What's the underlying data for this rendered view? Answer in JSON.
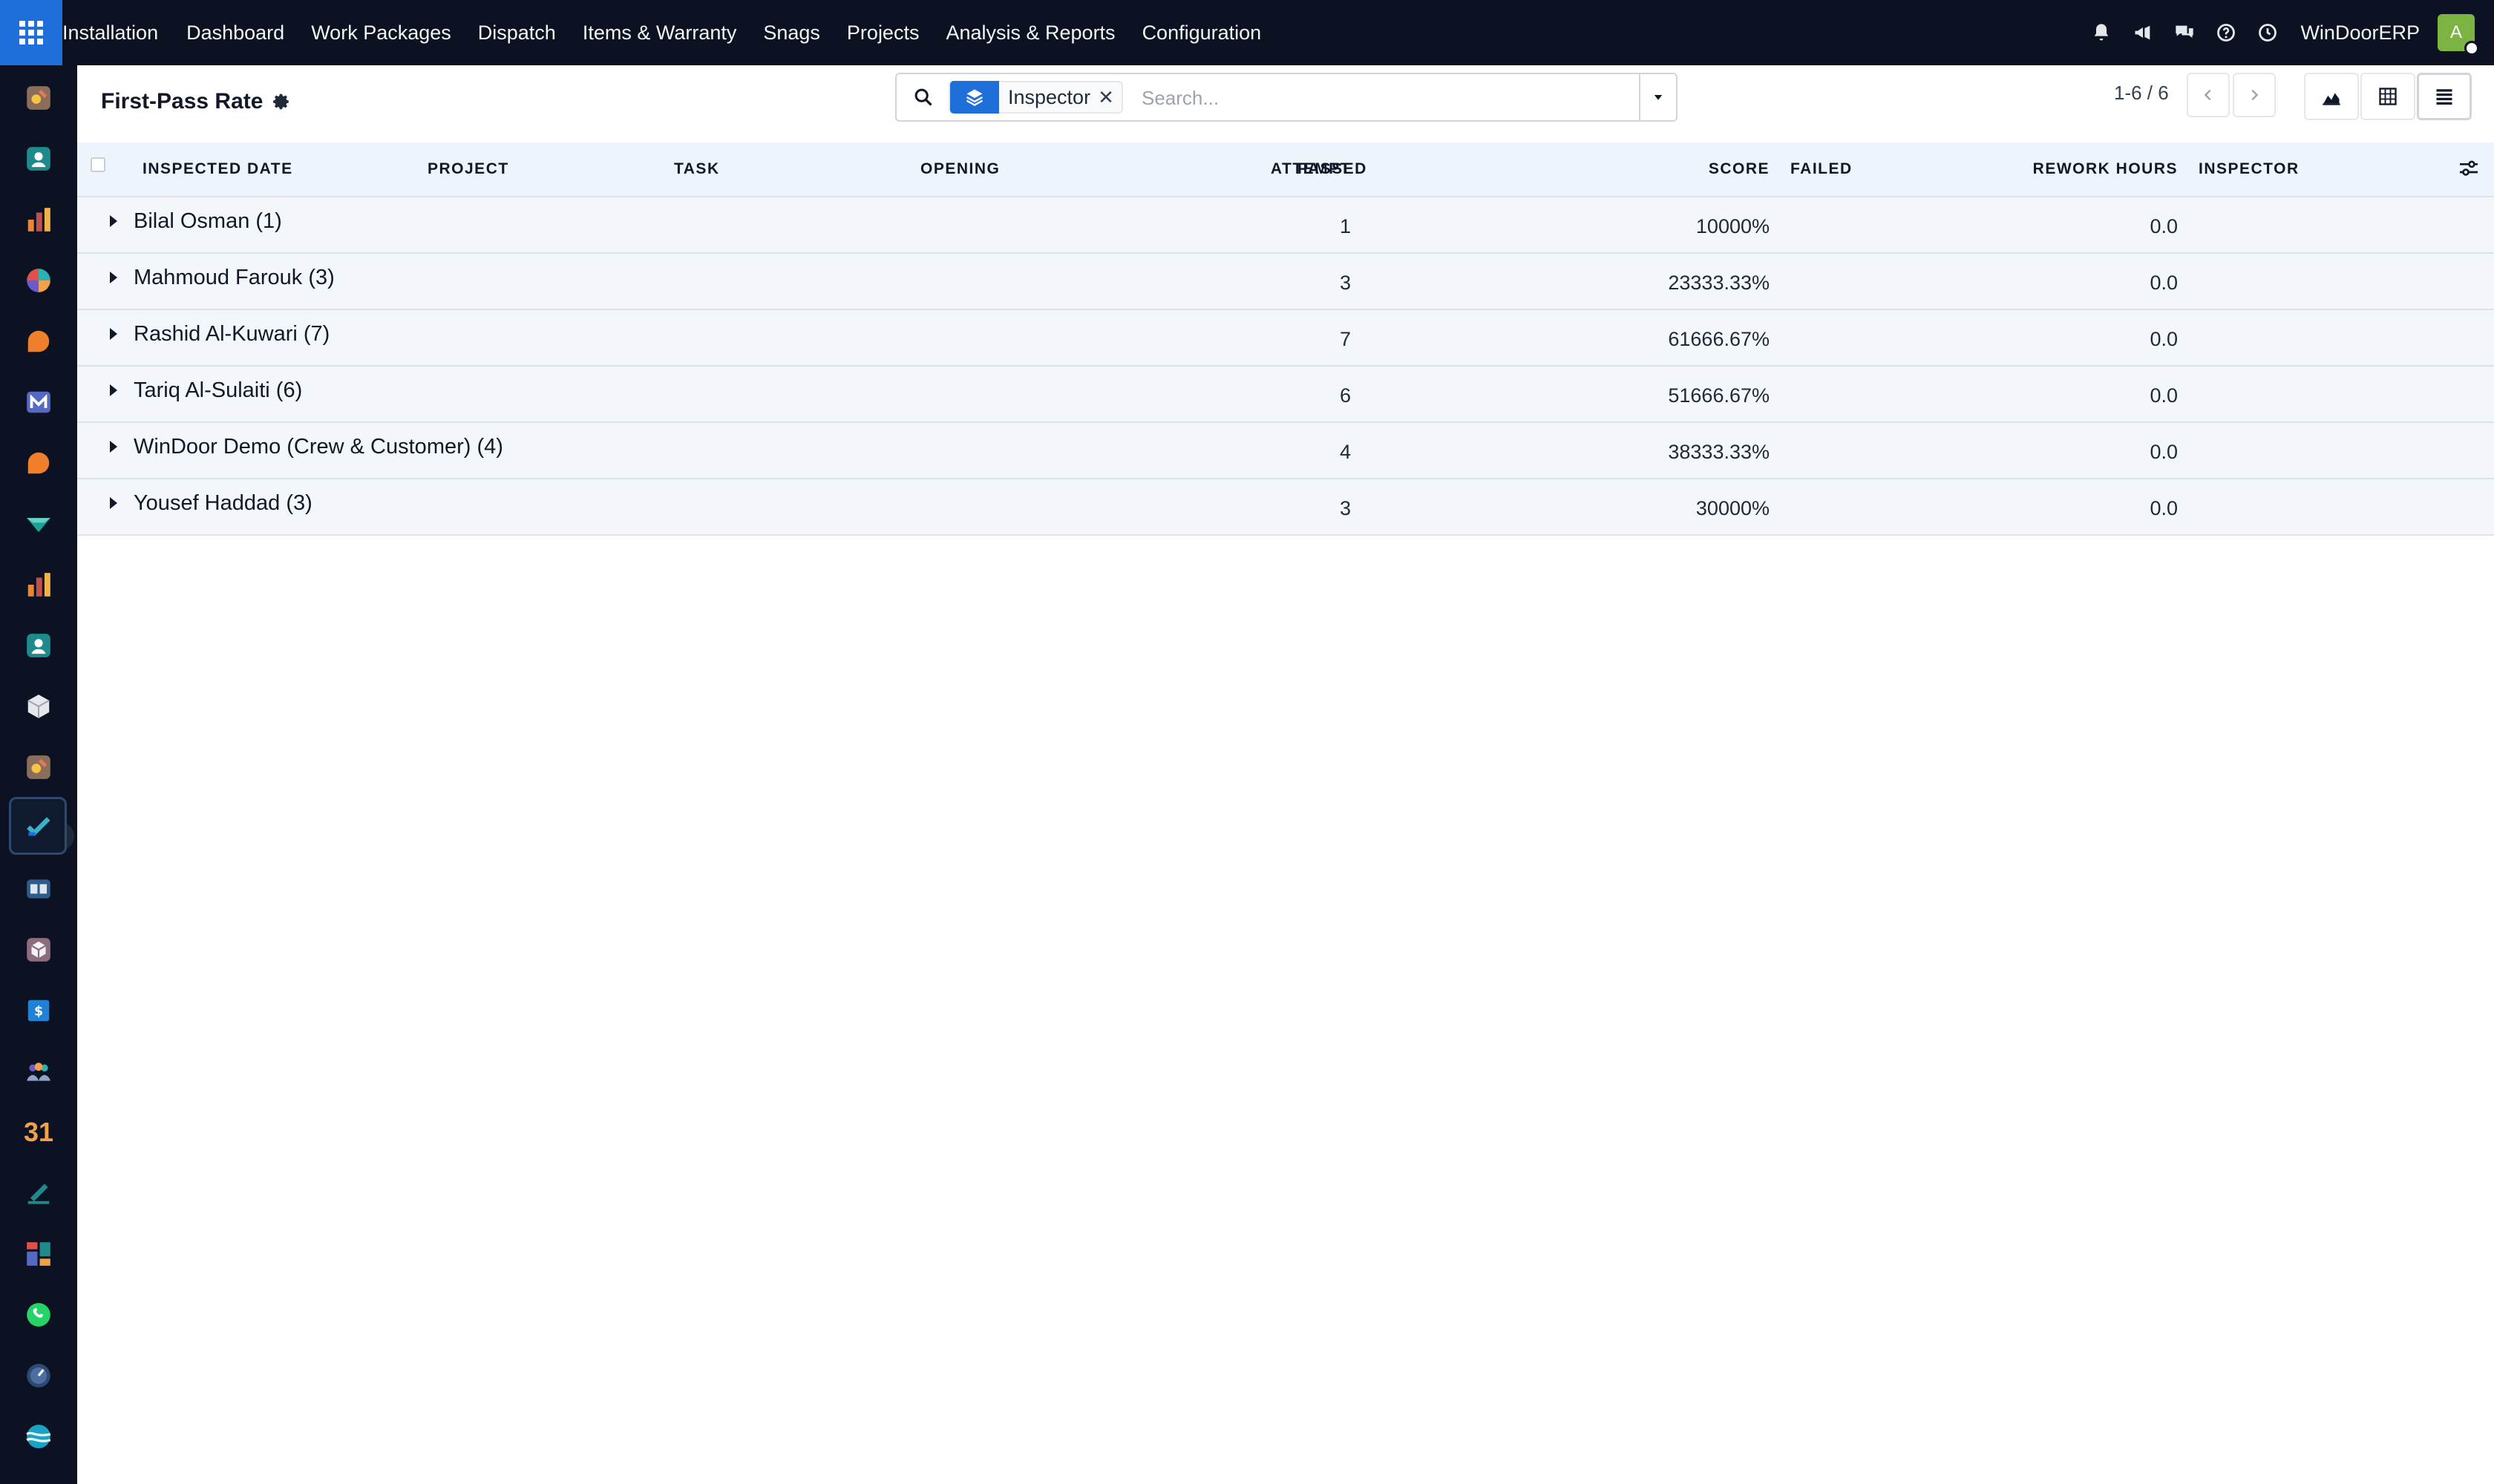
{
  "topnav": {
    "app_name": "Installation",
    "menu": [
      "Dashboard",
      "Work Packages",
      "Dispatch",
      "Items & Warranty",
      "Snags",
      "Projects",
      "Analysis & Reports",
      "Configuration"
    ],
    "company": "WinDoorERP",
    "avatar_initial": "A"
  },
  "sidebar": {
    "icons": [
      "discuss-icon",
      "contacts-icon",
      "reporting-icon",
      "crm-icon",
      "chat-icon",
      "mail-icon",
      "livechat-icon",
      "project-icon",
      "sales-reporting-icon",
      "employees-icon",
      "inventory-icon",
      "installation-icon",
      "quality-check-icon",
      "knowledge-icon",
      "manufacturing-icon",
      "invoicing-icon",
      "team-icon",
      "calendar-icon",
      "sign-icon",
      "dashboards-icon",
      "whatsapp-icon",
      "clock-icon",
      "website-icon"
    ],
    "calendar_text": "31"
  },
  "control": {
    "title": "First-Pass Rate",
    "facet_label": "Inspector",
    "search_placeholder": "Search...",
    "pager": "1-6 / 6"
  },
  "table": {
    "columns": [
      "INSPECTED DATE",
      "PROJECT",
      "TASK",
      "OPENING",
      "ATTEMPT",
      "PASSED",
      "SCORE",
      "FAILED",
      "REWORK HOURS",
      "INSPECTOR"
    ],
    "groups": [
      {
        "label": "Bilal Osman (1)",
        "attempt": "1",
        "score": "10000%",
        "rework": "0.0"
      },
      {
        "label": "Mahmoud Farouk (3)",
        "attempt": "3",
        "score": "23333.33%",
        "rework": "0.0"
      },
      {
        "label": "Rashid Al-Kuwari (7)",
        "attempt": "7",
        "score": "61666.67%",
        "rework": "0.0"
      },
      {
        "label": "Tariq Al-Sulaiti (6)",
        "attempt": "6",
        "score": "51666.67%",
        "rework": "0.0"
      },
      {
        "label": "WinDoor Demo (Crew & Customer) (4)",
        "attempt": "4",
        "score": "38333.33%",
        "rework": "0.0"
      },
      {
        "label": "Yousef Haddad (3)",
        "attempt": "3",
        "score": "30000%",
        "rework": "0.0"
      }
    ]
  },
  "colors": {
    "topbar": "#0c1222",
    "accent": "#1e6fd9",
    "header_row": "#eef4fb",
    "group_row": "#f3f7fb"
  }
}
